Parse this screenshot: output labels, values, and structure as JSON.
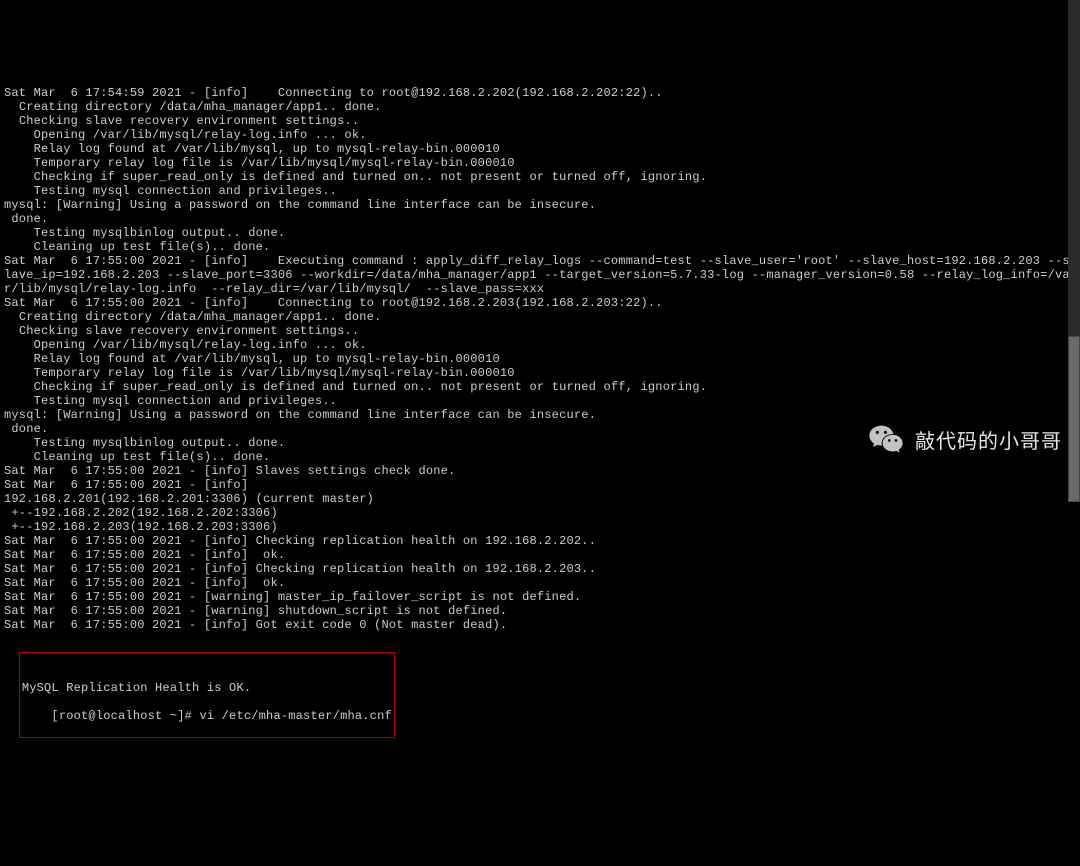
{
  "terminal": {
    "lines": [
      "Sat Mar  6 17:54:59 2021 - [info]    Connecting to root@192.168.2.202(192.168.2.202:22).. ",
      "  Creating directory /data/mha_manager/app1.. done.",
      "  Checking slave recovery environment settings..",
      "    Opening /var/lib/mysql/relay-log.info ... ok.",
      "    Relay log found at /var/lib/mysql, up to mysql-relay-bin.000010",
      "    Temporary relay log file is /var/lib/mysql/mysql-relay-bin.000010",
      "    Checking if super_read_only is defined and turned on.. not present or turned off, ignoring.",
      "    Testing mysql connection and privileges..",
      "mysql: [Warning] Using a password on the command line interface can be insecure.",
      " done.",
      "    Testing mysqlbinlog output.. done.",
      "    Cleaning up test file(s).. done.",
      "Sat Mar  6 17:55:00 2021 - [info]    Executing command : apply_diff_relay_logs --command=test --slave_user='root' --slave_host=192.168.2.203 --slave_ip=192.168.2.203 --slave_port=3306 --workdir=/data/mha_manager/app1 --target_version=5.7.33-log --manager_version=0.58 --relay_log_info=/var/lib/mysql/relay-log.info  --relay_dir=/var/lib/mysql/  --slave_pass=xxx",
      "Sat Mar  6 17:55:00 2021 - [info]    Connecting to root@192.168.2.203(192.168.2.203:22).. ",
      "  Creating directory /data/mha_manager/app1.. done.",
      "  Checking slave recovery environment settings..",
      "    Opening /var/lib/mysql/relay-log.info ... ok.",
      "    Relay log found at /var/lib/mysql, up to mysql-relay-bin.000010",
      "    Temporary relay log file is /var/lib/mysql/mysql-relay-bin.000010",
      "    Checking if super_read_only is defined and turned on.. not present or turned off, ignoring.",
      "    Testing mysql connection and privileges..",
      "mysql: [Warning] Using a password on the command line interface can be insecure.",
      " done.",
      "    Testing mysqlbinlog output.. done.",
      "    Cleaning up test file(s).. done.",
      "Sat Mar  6 17:55:00 2021 - [info] Slaves settings check done.",
      "Sat Mar  6 17:55:00 2021 - [info] ",
      "192.168.2.201(192.168.2.201:3306) (current master)",
      " +--192.168.2.202(192.168.2.202:3306)",
      " +--192.168.2.203(192.168.2.203:3306)",
      "",
      "Sat Mar  6 17:55:00 2021 - [info] Checking replication health on 192.168.2.202..",
      "Sat Mar  6 17:55:00 2021 - [info]  ok.",
      "Sat Mar  6 17:55:00 2021 - [info] Checking replication health on 192.168.2.203..",
      "Sat Mar  6 17:55:00 2021 - [info]  ok.",
      "Sat Mar  6 17:55:00 2021 - [warning] master_ip_failover_script is not defined.",
      "Sat Mar  6 17:55:00 2021 - [warning] shutdown_script is not defined.",
      "Sat Mar  6 17:55:00 2021 - [info] Got exit code 0 (Not master dead).",
      ""
    ],
    "highlight": {
      "status": "MySQL Replication Health is OK.",
      "prompt": "[root@localhost ~]# vi /etc/mha-master",
      "prompt_tail": "/mha.cnf"
    }
  },
  "watermark": {
    "text": "敲代码的小哥哥"
  }
}
